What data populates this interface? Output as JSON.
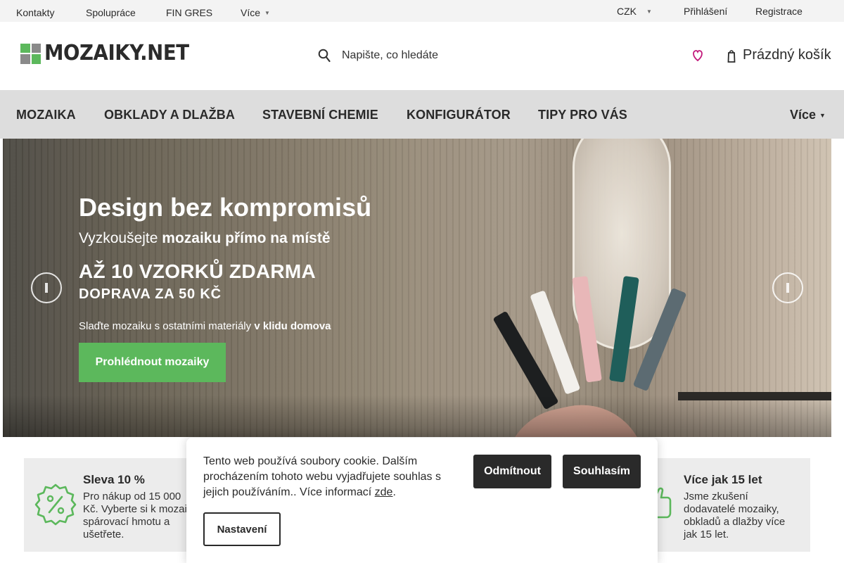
{
  "topbar": {
    "links": [
      "Kontakty",
      "Spolupráce",
      "FIN GRES",
      "Více"
    ],
    "currency": "CZK",
    "login": "Přihlášení",
    "register": "Registrace"
  },
  "header": {
    "logo_text": "MOZAIKY.NET",
    "logo_colors": [
      "#5cb85c",
      "#8a8a8a",
      "#8a8a8a",
      "#5cb85c"
    ],
    "search_placeholder": "Napište, co hledáte",
    "cart_label": "Prázdný košík",
    "heart_color": "#c2187a"
  },
  "nav": {
    "items": [
      "MOZAIKA",
      "OBKLADY A DLAŽBA",
      "STAVEBNÍ CHEMIE",
      "KONFIGURÁTOR",
      "TIPY PRO VÁS"
    ],
    "more": "Více"
  },
  "hero": {
    "title": "Design bez kompromisů",
    "subtitle_plain": "Vyzkoušejte ",
    "subtitle_bold": "mozaiku přímo na místě",
    "headline": "AŽ 10 VZORKŮ ZDARMA",
    "subheadline": "DOPRAVA ZA 50 KČ",
    "note_plain": "Slaďte mozaiku s ostatními materiály ",
    "note_bold": "v klidu domova",
    "cta": "Prohlédnout mozaiky",
    "cta_color": "#5cb85c",
    "tile_colors": [
      "#1d1f20",
      "#f2f0ec",
      "#e8b7b8",
      "#1f5e5a",
      "#5c6b72"
    ]
  },
  "benefits": [
    {
      "icon": "percent-badge-icon",
      "title": "Sleva 10 %",
      "text": [
        "Pro nákup od 15 000",
        "Kč. Vyberte si k mozai",
        "spárovací hmotu a",
        "ušetřete."
      ]
    },
    {
      "icon": "thumbs-up-icon",
      "title": "Více jak 15 let",
      "text": [
        "Jsme zkušení",
        "dodavatelé mozaiky,",
        "obkladů a dlažby více",
        "jak 15 let."
      ]
    }
  ],
  "cookie": {
    "text": "Tento web používá soubory cookie. Dalším procházením tohoto webu vyjadřujete souhlas s jejich používáním.. Více informací ",
    "link": "zde",
    "reject": "Odmítnout",
    "accept": "Souhlasím",
    "settings": "Nastavení"
  }
}
